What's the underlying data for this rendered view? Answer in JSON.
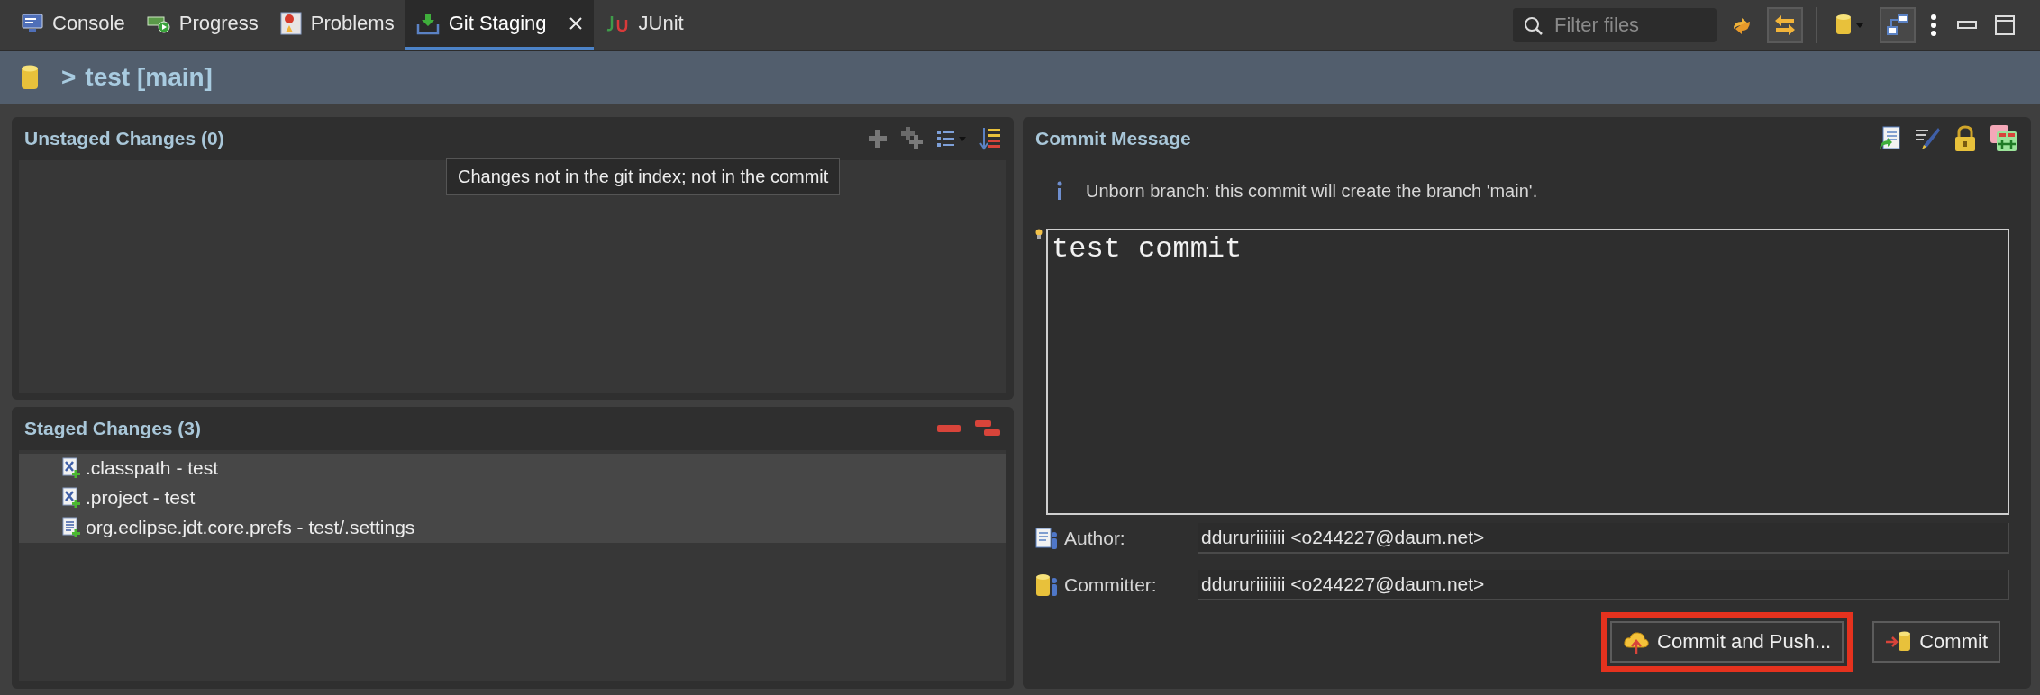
{
  "tabs": [
    {
      "label": "Console",
      "selected": false,
      "closable": false
    },
    {
      "label": "Progress",
      "selected": false,
      "closable": false
    },
    {
      "label": "Problems",
      "selected": false,
      "closable": false
    },
    {
      "label": "Git Staging",
      "selected": true,
      "closable": true
    },
    {
      "label": "JUnit",
      "selected": false,
      "closable": false
    }
  ],
  "filter": {
    "placeholder": "Filter files"
  },
  "repository": {
    "arrow": ">",
    "title": "test [main]"
  },
  "unstaged": {
    "title": "Unstaged Changes (0)",
    "tooltip": "Changes not in the git index; not in the commit"
  },
  "staged": {
    "title": "Staged Changes (3)",
    "files": [
      {
        "name": ".classpath - test",
        "kind": "xml"
      },
      {
        "name": ".project - test",
        "kind": "xml"
      },
      {
        "name": "org.eclipse.jdt.core.prefs - test/.settings",
        "kind": "text"
      }
    ]
  },
  "commit": {
    "title": "Commit Message",
    "info": "Unborn branch: this commit will create the branch 'main'.",
    "message": "test commit",
    "author": {
      "label": "Author:",
      "value": "ddururiiiiiii <o244227@daum.net>"
    },
    "committer": {
      "label": "Committer:",
      "value": "ddururiiiiiii <o244227@daum.net>"
    },
    "buttons": [
      {
        "label": "Commit and Push...",
        "kind": "push",
        "highlighted": true
      },
      {
        "label": "Commit",
        "kind": "commit",
        "highlighted": false
      }
    ]
  }
}
